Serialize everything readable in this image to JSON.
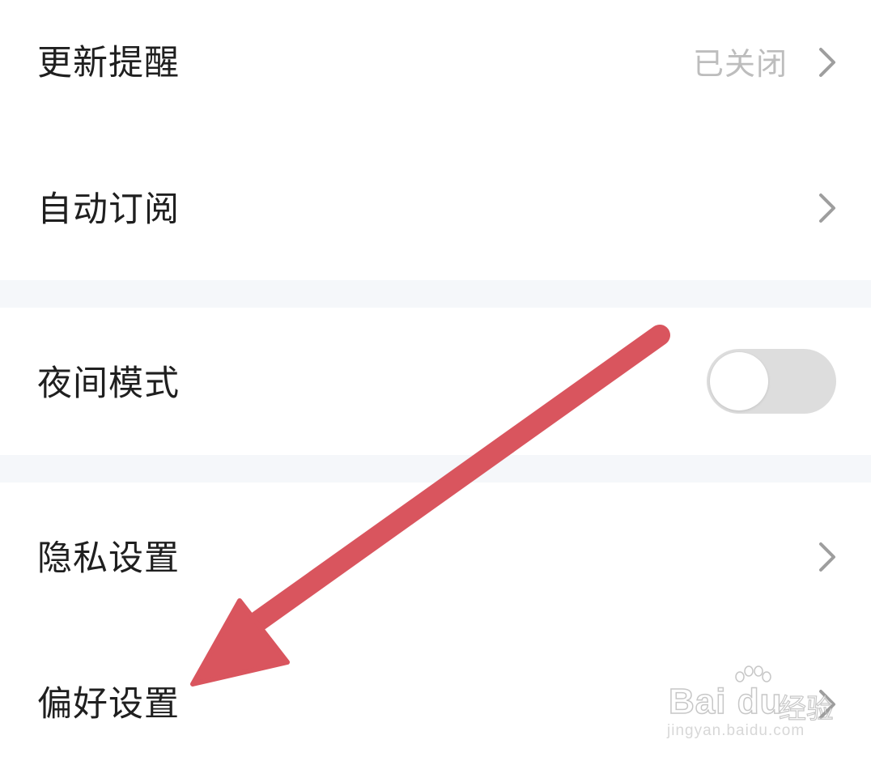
{
  "settings": {
    "update_reminder": {
      "label": "更新提醒",
      "value": "已关闭"
    },
    "auto_subscribe": {
      "label": "自动订阅"
    },
    "night_mode": {
      "label": "夜间模式",
      "enabled": false
    },
    "privacy_settings": {
      "label": "隐私设置"
    },
    "preference_settings": {
      "label": "偏好设置"
    }
  },
  "colors": {
    "label": "#1f1f1f",
    "value": "#bdbdbd",
    "chevron": "#9e9e9e",
    "divider": "#f5f7fa",
    "toggle_off": "#dddddd",
    "annotation_arrow": "#d9555e"
  },
  "annotation": {
    "type": "arrow",
    "points_to": "preference-settings-row"
  },
  "watermark": {
    "logo": "Bai du",
    "suffix": "经验",
    "url": "jingyan.baidu.com"
  }
}
